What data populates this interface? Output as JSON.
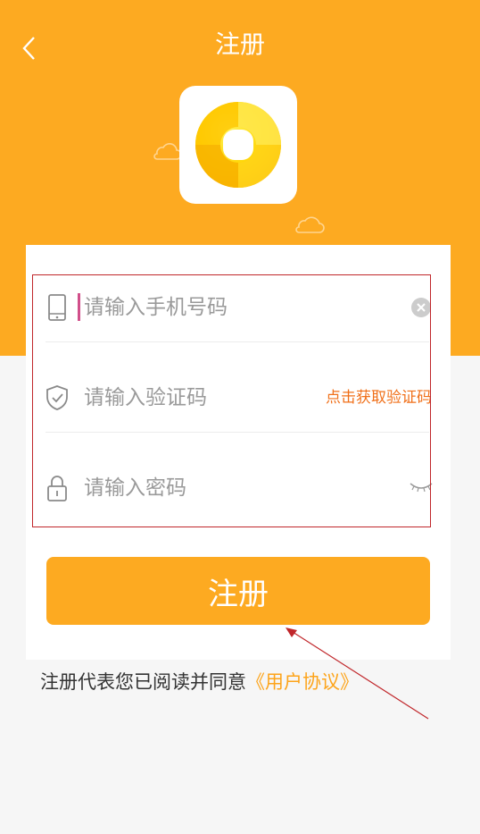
{
  "header": {
    "title": "注册",
    "back_icon": "chevron-left-icon",
    "background_color": "#fdaa21"
  },
  "logo": {
    "icon": "app-logo-swirl"
  },
  "form": {
    "phone": {
      "placeholder": "请输入手机号码",
      "value": "",
      "icon": "phone-icon",
      "clear_icon": "clear-icon"
    },
    "code": {
      "placeholder": "请输入验证码",
      "value": "",
      "icon": "shield-check-icon",
      "get_code_label": "点击获取验证码"
    },
    "password": {
      "placeholder": "请输入密码",
      "value": "",
      "icon": "lock-icon",
      "visibility_icon": "eye-closed-icon"
    }
  },
  "submit_label": "注册",
  "agreement": {
    "prefix": "注册代表您已阅读并同意",
    "link_label": "《用户协议》"
  },
  "colors": {
    "accent": "#fdaa21",
    "link": "#fda41a",
    "get_code": "#f0701a",
    "annotation": "#c0262a"
  }
}
